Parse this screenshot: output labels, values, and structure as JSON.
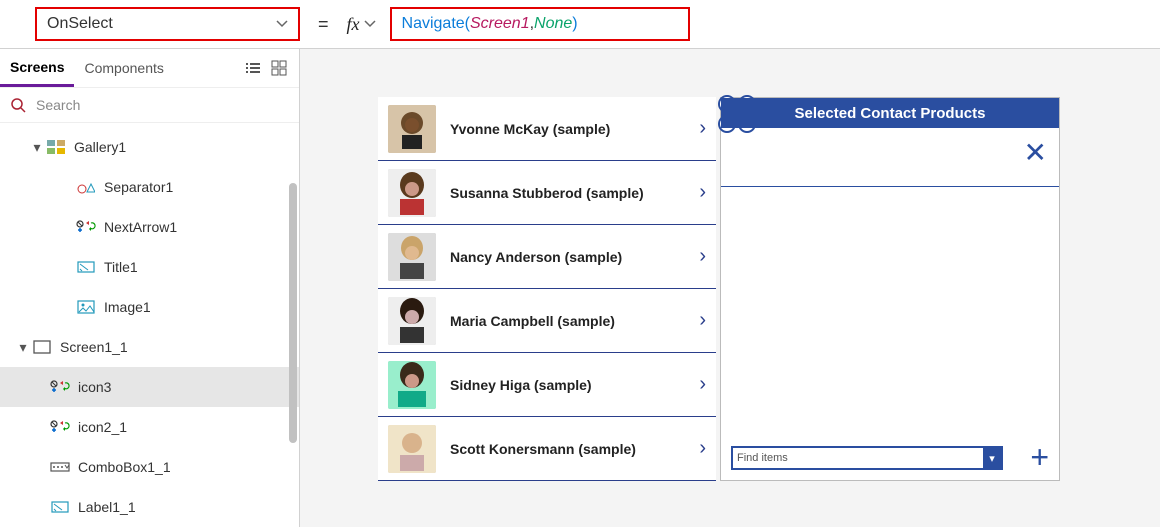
{
  "formulaBar": {
    "property": "OnSelect",
    "eq": "=",
    "fx": "fx",
    "formula": {
      "fn": "Navigate",
      "open": "( ",
      "arg1": "Screen1",
      "comma": ", ",
      "arg2": "None",
      "close": " )"
    }
  },
  "treePanel": {
    "tabs": {
      "screens": "Screens",
      "components": "Components"
    },
    "search": {
      "placeholder": "Search"
    },
    "nodes": {
      "gallery1": "Gallery1",
      "separator1": "Separator1",
      "nextarrow1": "NextArrow1",
      "title1": "Title1",
      "image1": "Image1",
      "screen1_1": "Screen1_1",
      "icon3": "icon3",
      "icon2_1": "icon2_1",
      "combobox1_1": "ComboBox1_1",
      "label1_1": "Label1_1"
    }
  },
  "gallery": {
    "items": [
      {
        "name": "Yvonne McKay (sample)"
      },
      {
        "name": "Susanna Stubberod (sample)"
      },
      {
        "name": "Nancy Anderson (sample)"
      },
      {
        "name": "Maria Campbell (sample)"
      },
      {
        "name": "Sidney Higa (sample)"
      },
      {
        "name": "Scott Konersmann (sample)"
      }
    ]
  },
  "rightPane": {
    "title": "Selected Contact Products",
    "comboPlaceholder": "Find items",
    "closeGlyph": "✕",
    "addGlyph": "+"
  }
}
